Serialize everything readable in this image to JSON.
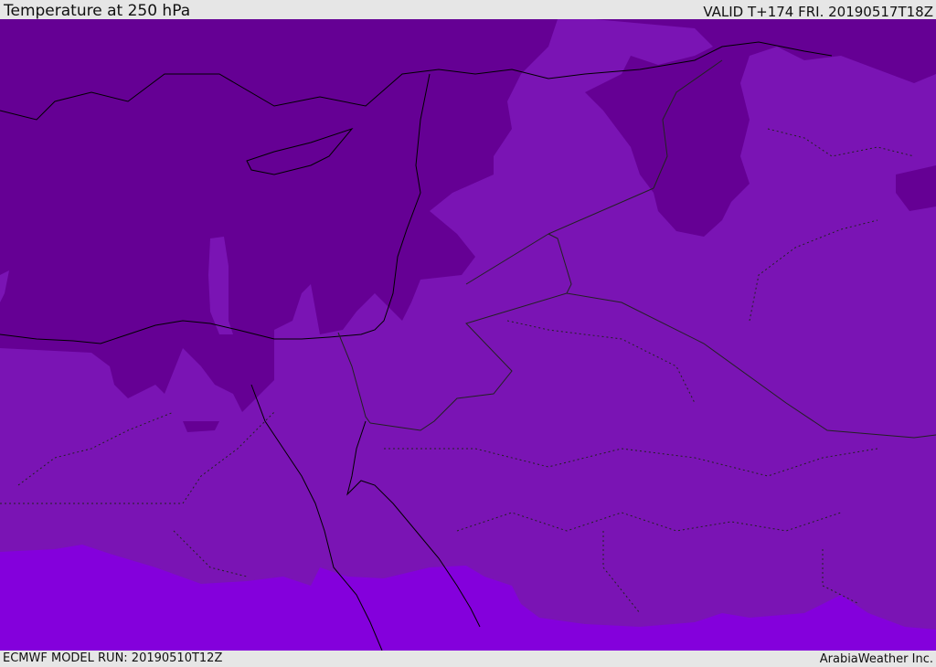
{
  "header": {
    "title": "Temperature at 250 hPa",
    "valid": "VALID T+174 FRI. 20190517T18Z"
  },
  "footer": {
    "model_run": "ECMWF MODEL RUN: 20190510T12Z",
    "credit": "ArabiaWeather Inc."
  },
  "colors": {
    "band_cold": "#650094",
    "band_mid": "#7a14b4",
    "band_warm": "#8400dc",
    "coastline": "#000000",
    "borders": "#222222"
  }
}
